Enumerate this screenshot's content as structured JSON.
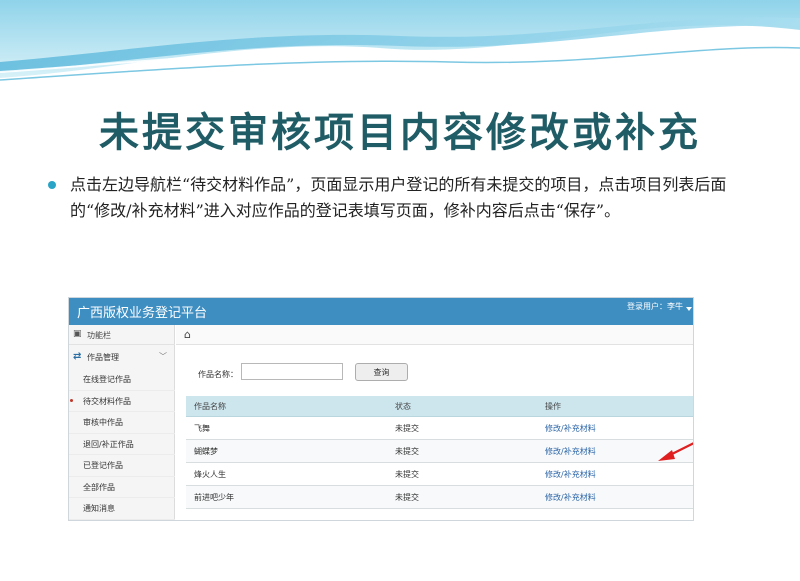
{
  "slide": {
    "title": "未提交审核项目内容修改或补充",
    "bullet": "点击左边导航栏“待交材料作品”，页面显示用户登记的所有未提交的项目，点击项目列表后面的“修改/补充材料”进入对应作品的登记表填写页面，修补内容后点击“保存”。"
  },
  "app": {
    "title": "广西版权业务登记平台",
    "user": "登录用户：李牛"
  },
  "sidebar": {
    "header_icon": "briefcase-icon",
    "header_label": "功能栏",
    "group_icon": "swap-arrows-icon",
    "group_label": "作品管理",
    "group_caret": "﹀",
    "items": [
      {
        "label": "在线登记作品"
      },
      {
        "label": "待交材料作品"
      },
      {
        "label": "审核中作品"
      },
      {
        "label": "退回/补正作品"
      },
      {
        "label": "已登记作品"
      },
      {
        "label": "全部作品"
      },
      {
        "label": "通知消息"
      }
    ]
  },
  "content": {
    "home_icon": "home-icon",
    "search_label": "作品名称：",
    "search_value": "",
    "query_label": "查询"
  },
  "table": {
    "headers": [
      "作品名称",
      "状态",
      "操作"
    ],
    "rows": [
      {
        "name": "飞舞",
        "status": "未提交",
        "action": "修改/补充材料"
      },
      {
        "name": "蝴蝶梦",
        "status": "未提交",
        "action": "修改/补充材料"
      },
      {
        "name": "烽火人生",
        "status": "未提交",
        "action": "修改/补充材料"
      },
      {
        "name": "前进吧少年",
        "status": "未提交",
        "action": "修改/补充材料"
      }
    ]
  },
  "colors": {
    "title": "#1f5c66",
    "header_bar": "#3e8ec2",
    "table_head": "#cde6ee",
    "link": "#2a64a8",
    "annotation_arrow": "#e02020"
  }
}
